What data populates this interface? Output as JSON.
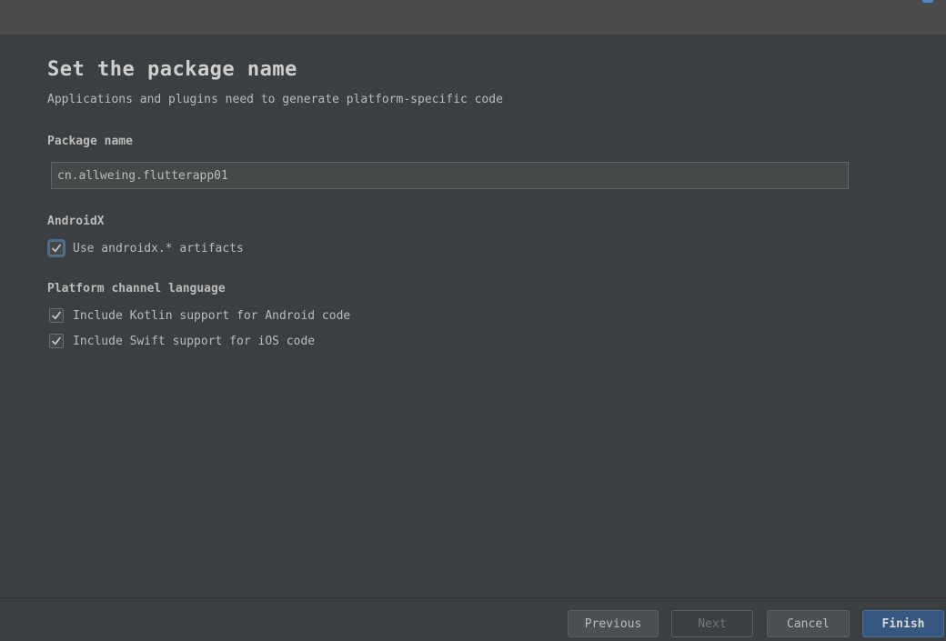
{
  "header": {
    "title": "Set the package name",
    "subtitle": "Applications and plugins need to generate platform-specific code"
  },
  "package": {
    "label": "Package name",
    "value": "cn.allweing.flutterapp01"
  },
  "androidx": {
    "label": "AndroidX",
    "option_label": "Use androidx.* artifacts",
    "checked": true
  },
  "platform_channel": {
    "label": "Platform channel language",
    "options": [
      {
        "label": "Include Kotlin support for Android code",
        "checked": true
      },
      {
        "label": "Include Swift support for iOS code",
        "checked": true
      }
    ]
  },
  "buttons": {
    "previous": "Previous",
    "next": "Next",
    "cancel": "Cancel",
    "finish": "Finish"
  },
  "colors": {
    "background": "#3c3f41",
    "primary_button": "#365880",
    "focus_ring": "#466d94"
  },
  "icons": {
    "checkbox_mark": "checkmark-icon"
  }
}
